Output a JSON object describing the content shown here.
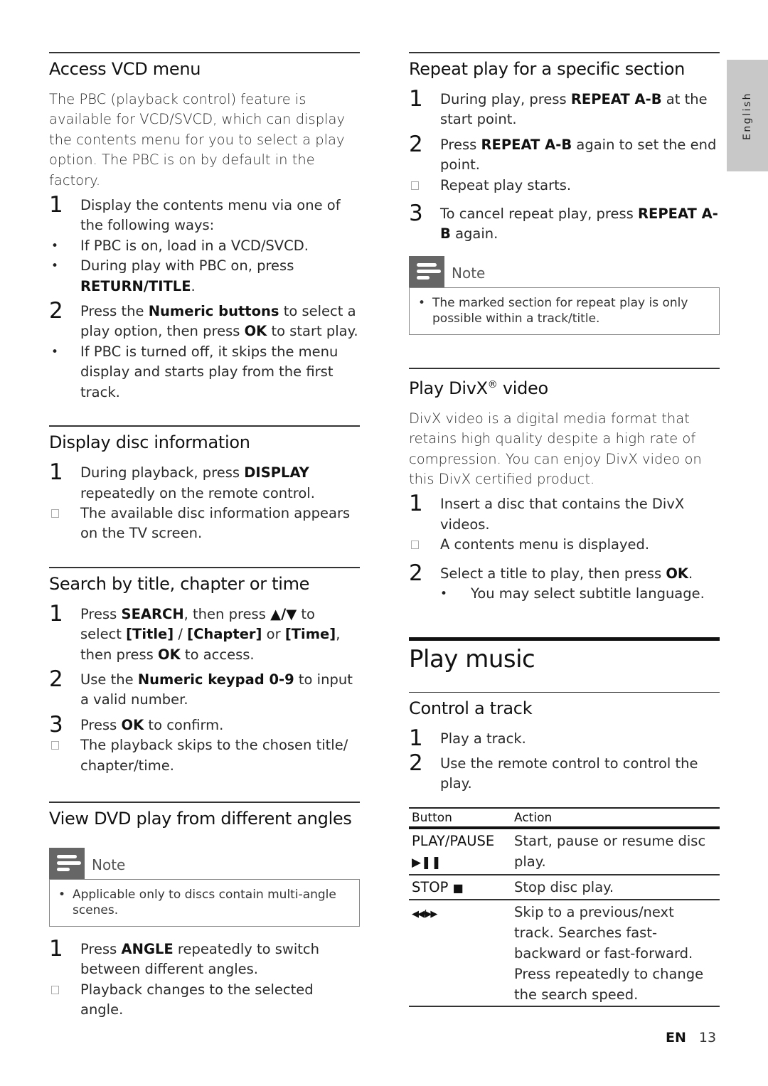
{
  "side_tab": {
    "label": "English"
  },
  "footer": {
    "language": "EN",
    "page_number": "13"
  },
  "left_column": {
    "access_vcd": {
      "title": "Access VCD menu",
      "intro": "The PBC (playback control) feature is available for VCD/SVCD, which can display the contents menu for you to select a play option. The PBC is on by default in the factory.",
      "steps": [
        {
          "num": "1",
          "text": "Display the contents menu via one of the following ways:",
          "bullets": [
            "If PBC is on, load in a VCD/SVCD.",
            {
              "pre": "During play with PBC on, press ",
              "bold": "RETURN/TITLE",
              "post": "."
            }
          ]
        },
        {
          "num": "2",
          "pre": "Press the ",
          "bold1": "Numeric buttons",
          "mid": " to select a play option, then press ",
          "bold2": "OK",
          "post": " to start play.",
          "bullets": [
            "If PBC is turned off, it skips the menu display and starts play from the first track."
          ]
        }
      ]
    },
    "disc_info": {
      "title": "Display disc information",
      "steps": [
        {
          "num": "1",
          "pre": "During playback, press ",
          "bold": "DISPLAY",
          "post": " repeatedly on the remote control.",
          "result": "The available disc information appears on the TV screen."
        }
      ]
    },
    "search": {
      "title": "Search by title, chapter or time",
      "steps": [
        {
          "num": "1",
          "pre": "Press ",
          "b1": "SEARCH",
          "t1": ", then press ",
          "b2": "▲/▼",
          "t2": " to select ",
          "b3": "[Title]",
          "t3": " / ",
          "b4": "[Chapter]",
          "t4": " or ",
          "b5": "[Time]",
          "t5": ", then press ",
          "b6": "OK",
          "t6": " to access."
        },
        {
          "num": "2",
          "pre": "Use the ",
          "bold": "Numeric keypad 0-9",
          "post": " to input a valid number."
        },
        {
          "num": "3",
          "pre": "Press ",
          "bold": "OK",
          "post": " to confirm.",
          "result": "The playback skips to the chosen title/ chapter/time."
        }
      ]
    },
    "angles": {
      "title": "View DVD play from different angles",
      "note_label": "Note",
      "note_text": "Applicable only to discs contain multi-angle scenes.",
      "steps": [
        {
          "num": "1",
          "pre": "Press ",
          "bold": "ANGLE",
          "post": " repeatedly to switch between different angles.",
          "result": "Playback changes to the selected angle."
        }
      ]
    }
  },
  "right_column": {
    "repeat_ab": {
      "title": "Repeat play for a specific section",
      "steps": [
        {
          "num": "1",
          "pre": "During play, press ",
          "bold": "REPEAT A-B",
          "post": " at the start point."
        },
        {
          "num": "2",
          "pre": "Press ",
          "bold": "REPEAT A-B",
          "post": " again to set the end point.",
          "result": "Repeat play starts."
        },
        {
          "num": "3",
          "pre": "To cancel repeat play, press ",
          "bold": "REPEAT A-B",
          "post": " again."
        }
      ],
      "note_label": "Note",
      "note_text": "The marked section for repeat play is only possible within a track/title."
    },
    "divx": {
      "title_pre": "Play DivX",
      "title_sup": "®",
      "title_post": " video",
      "intro": "DivX video is a digital media format that retains high quality despite a high rate of compression. You can enjoy DivX video on this DivX certified product.",
      "steps": [
        {
          "num": "1",
          "text": "Insert a disc that contains the DivX videos.",
          "result": "A contents menu is displayed."
        },
        {
          "num": "2",
          "pre": "Select a title to play, then press ",
          "bold": "OK",
          "post": ".",
          "bullet": "You may select subtitle language."
        }
      ]
    },
    "play_music": {
      "title": "Play music",
      "control_title": "Control a track",
      "steps": [
        {
          "num": "1",
          "text": "Play a track."
        },
        {
          "num": "2",
          "text": "Use the remote control to control the play."
        }
      ],
      "table": {
        "headers": [
          "Button",
          "Action"
        ],
        "rows": [
          {
            "button": "PLAY/PAUSE",
            "button_icon": "▶❚❚",
            "action": "Start, pause or resume disc play."
          },
          {
            "button": "STOP",
            "button_icon": "■",
            "action": "Stop disc play."
          },
          {
            "button": "",
            "button_icon": "◀◀/▶▶",
            "action": "Skip to a previous/next track. Searches fast-backward or fast-forward. Press repeatedly to change the search speed."
          }
        ]
      }
    }
  }
}
